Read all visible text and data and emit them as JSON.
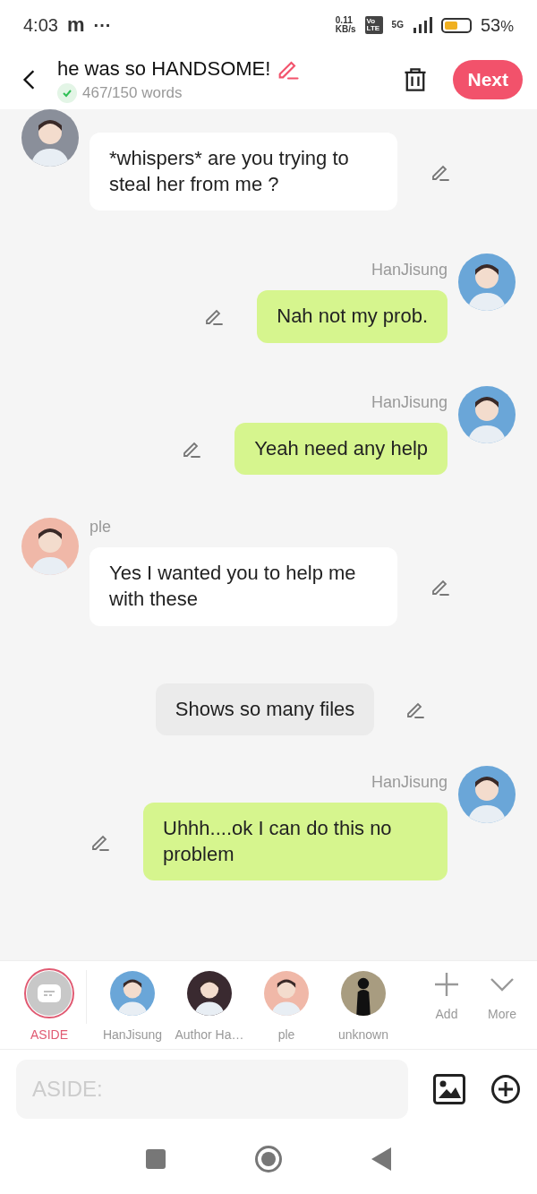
{
  "status_bar": {
    "time": "4:03",
    "app_mark": "m",
    "dots": "···",
    "speed": "0.11",
    "speed_unit": "KB/s",
    "volte": "Vo LTE",
    "network": "5G",
    "battery_text": "53",
    "battery_unit": "%"
  },
  "header": {
    "title": "he was so HANDSOME!",
    "word_count": "467/150 words",
    "goal_met": true,
    "next": "Next"
  },
  "messages": [
    {
      "kind": "left",
      "text": "*whispers* are you trying to steal her from me ?"
    },
    {
      "kind": "right",
      "name": "HanJisung",
      "text": "Nah not my prob."
    },
    {
      "kind": "right",
      "name": "HanJisung",
      "text": "Yeah need any help"
    },
    {
      "kind": "left",
      "name": "ple",
      "text": "Yes I wanted you to help me with these"
    },
    {
      "kind": "aside",
      "text": "Shows so many files"
    },
    {
      "kind": "right",
      "name": "HanJisung",
      "text": "Uhhh....ok I can do this no problem"
    }
  ],
  "cast": [
    {
      "kind": "aside",
      "label": "ASIDE",
      "selected": true
    },
    {
      "kind": "character",
      "label": "HanJisung",
      "selected": false
    },
    {
      "kind": "character",
      "label": "Author Ha…",
      "selected": false
    },
    {
      "kind": "character",
      "label": "ple",
      "selected": false
    },
    {
      "kind": "character",
      "label": "unknown",
      "selected": false
    }
  ],
  "cast_actions": [
    {
      "kind": "add",
      "label": "Add"
    },
    {
      "kind": "more",
      "label": "More"
    }
  ],
  "composer": {
    "placeholder": "ASIDE:"
  }
}
